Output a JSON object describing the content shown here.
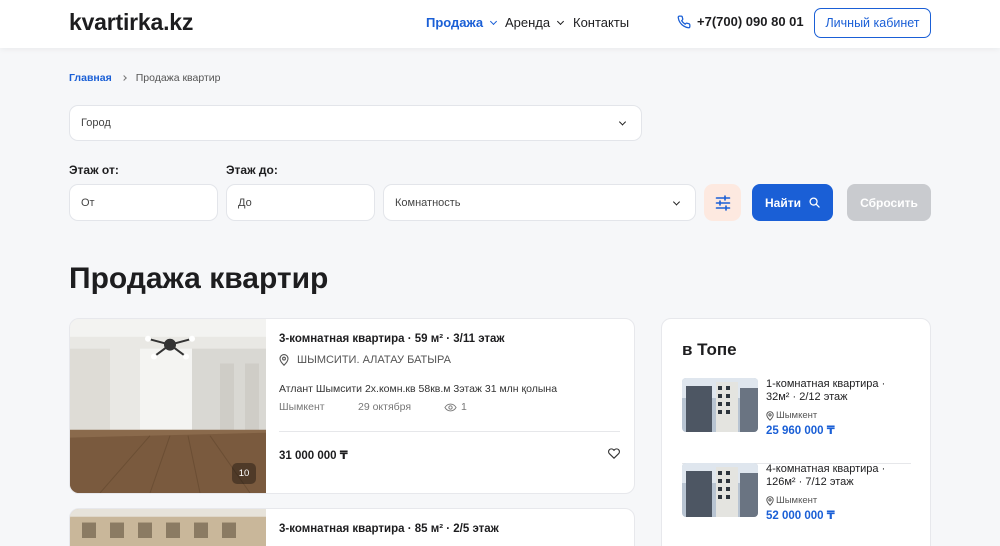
{
  "colors": {
    "accent": "#1a5fd6",
    "filter_bg": "#fde9e0",
    "reset_bg": "#c9cbcf"
  },
  "header": {
    "logo": "kvartirka.kz",
    "nav": [
      {
        "label": "Продажа",
        "active": true,
        "has_dropdown": true
      },
      {
        "label": "Аренда",
        "active": false,
        "has_dropdown": true
      },
      {
        "label": "Контакты",
        "active": false,
        "has_dropdown": false
      }
    ],
    "phone": "+7(700) 090 80 01",
    "cabinet_label": "Личный кабинет"
  },
  "breadcrumb": {
    "home": "Главная",
    "current": "Продажа квартир"
  },
  "filters": {
    "city_placeholder": "Город",
    "floor_from_label": "Этаж от:",
    "floor_to_label": "Этаж до:",
    "floor_from_placeholder": "От",
    "floor_to_placeholder": "До",
    "rooms_placeholder": "Комнатность",
    "find_label": "Найти",
    "reset_label": "Сбросить"
  },
  "page_title": "Продажа квартир",
  "listings": [
    {
      "title": "3-комнатная квартира · 59 м² · 3/11 этаж",
      "address": "ШЫМСИТИ. АЛАТАУ БАТЫРА",
      "description": "Атлант Шымсити 2х.комн.кв 58кв.м 3этаж 31 млн қолына",
      "city": "Шымкент",
      "date": "29 октября",
      "views": "1",
      "price": "31 000 000 ₸",
      "photo_count": "10"
    },
    {
      "title": "3-комнатная квартира · 85 м² · 2/5 этаж"
    }
  ],
  "top": {
    "title": "в Топе",
    "items": [
      {
        "name": "1-комнатная квартира · 32м² · 2/12 этаж",
        "city": "Шымкент",
        "price": "25 960 000 ₸"
      },
      {
        "name": "4-комнатная квартира · 126м² · 7/12 этаж",
        "city": "Шымкент",
        "price": "52 000 000 ₸"
      }
    ]
  }
}
